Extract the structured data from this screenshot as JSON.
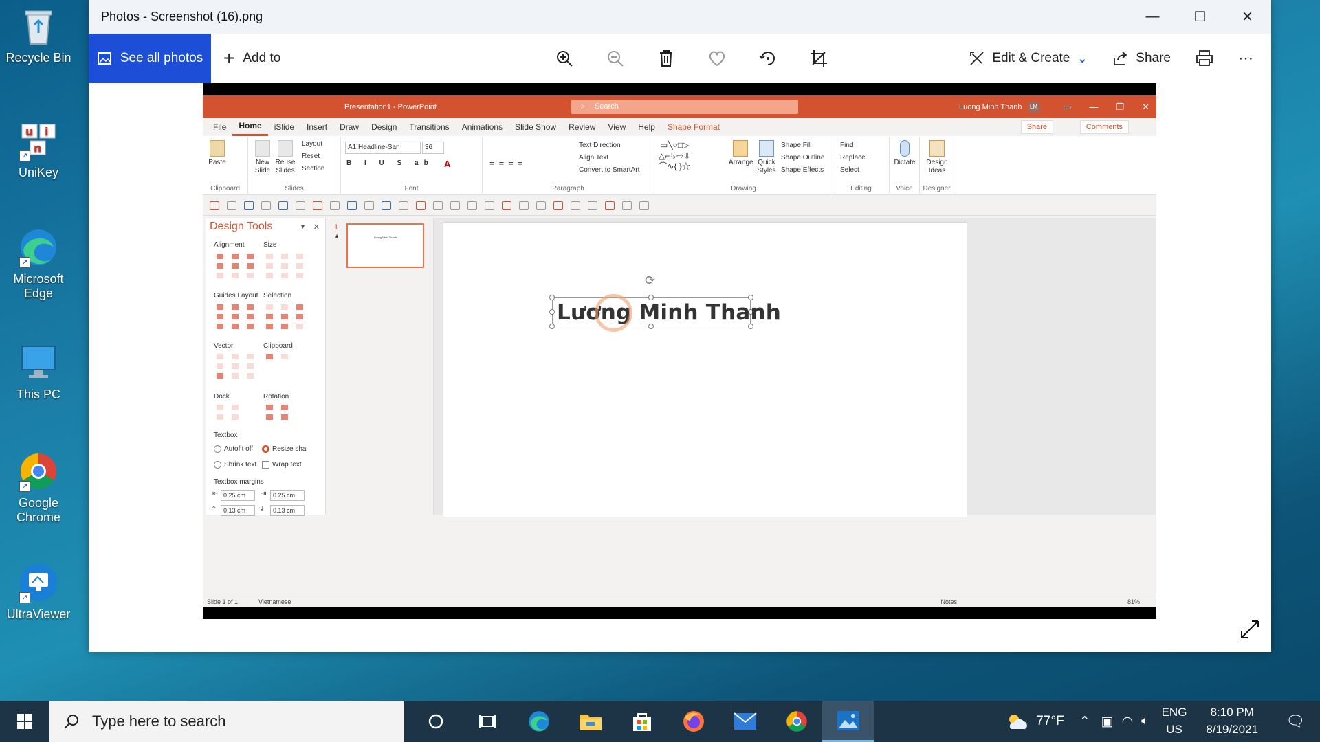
{
  "desktop": {
    "icons": [
      {
        "label": "Recycle Bin"
      },
      {
        "label": "UniKey"
      },
      {
        "label": "Microsoft Edge"
      },
      {
        "label": "This PC"
      },
      {
        "label": "Google Chrome"
      },
      {
        "label": "UltraViewer"
      }
    ]
  },
  "photos_app": {
    "window_title": "Photos - Screenshot (16).png",
    "see_all_label": "See all photos",
    "add_to_label": "Add to",
    "edit_create_label": "Edit & Create",
    "share_label": "Share",
    "more_label": "⋯"
  },
  "ppt": {
    "doc_title": "Presentation1 - PowerPoint",
    "search_placeholder": "Search",
    "user_name": "Luong Minh Thanh",
    "user_initials": "LM",
    "tabs": [
      "File",
      "Home",
      "iSlide",
      "Insert",
      "Draw",
      "Design",
      "Transitions",
      "Animations",
      "Slide Show",
      "Review",
      "View",
      "Help",
      "Shape Format"
    ],
    "share_label": "Share",
    "comments_label": "Comments",
    "ribbon": {
      "clipboard": {
        "paste": "Paste",
        "group": "Clipboard"
      },
      "slides": {
        "new_slide": "New Slide",
        "reuse_slides": "Reuse Slides",
        "layout": "Layout",
        "reset": "Reset",
        "section": "Section",
        "group": "Slides"
      },
      "font": {
        "font_name": "A1.Headline-San",
        "font_size": "36",
        "group": "Font"
      },
      "paragraph": {
        "text_direction": "Text Direction",
        "align_text": "Align Text",
        "convert_smartart": "Convert to SmartArt",
        "group": "Paragraph"
      },
      "drawing": {
        "arrange": "Arrange",
        "quick_styles": "Quick Styles",
        "shape_fill": "Shape Fill",
        "shape_outline": "Shape Outline",
        "shape_effects": "Shape Effects",
        "group": "Drawing"
      },
      "editing": {
        "find": "Find",
        "replace": "Replace",
        "select": "Select",
        "group": "Editing"
      },
      "voice": {
        "dictate": "Dictate",
        "group": "Voice"
      },
      "designer": {
        "design_ideas": "Design Ideas",
        "group": "Designer"
      }
    },
    "design_tools": {
      "title": "Design Tools",
      "sections": {
        "alignment": "Alignment",
        "size": "Size",
        "guides_layout": "Guides Layout",
        "selection": "Selection",
        "vector": "Vector",
        "clipboard": "Clipboard",
        "dock": "Dock",
        "rotation": "Rotation",
        "textbox": "Textbox",
        "textbox_margins": "Textbox margins"
      },
      "options": {
        "autofit_off": "Autofit off",
        "resize_shape": "Resize sha",
        "shrink_text": "Shrink text",
        "wrap_text": "Wrap text"
      },
      "margins": {
        "left": "0.25 cm",
        "right": "0.25 cm",
        "top": "0.13 cm",
        "bottom": "0.13 cm"
      }
    },
    "thumbnail": {
      "number": "1",
      "star": "★",
      "text": "Luong Minh Thanh"
    },
    "slide_title": "Lương Minh Thanh",
    "status": {
      "slide_count": "Slide 1 of 1",
      "language": "Vietnamese",
      "notes": "Notes",
      "zoom": "81%"
    }
  },
  "taskbar": {
    "search_placeholder": "Type here to search",
    "weather": "77°F",
    "lang_top": "ENG",
    "lang_bottom": "US",
    "time": "8:10 PM",
    "date": "8/19/2021"
  },
  "colors": {
    "ppt_accent": "#d35230",
    "photos_accent": "#1c4ed8",
    "taskbar": "#1d3446"
  }
}
